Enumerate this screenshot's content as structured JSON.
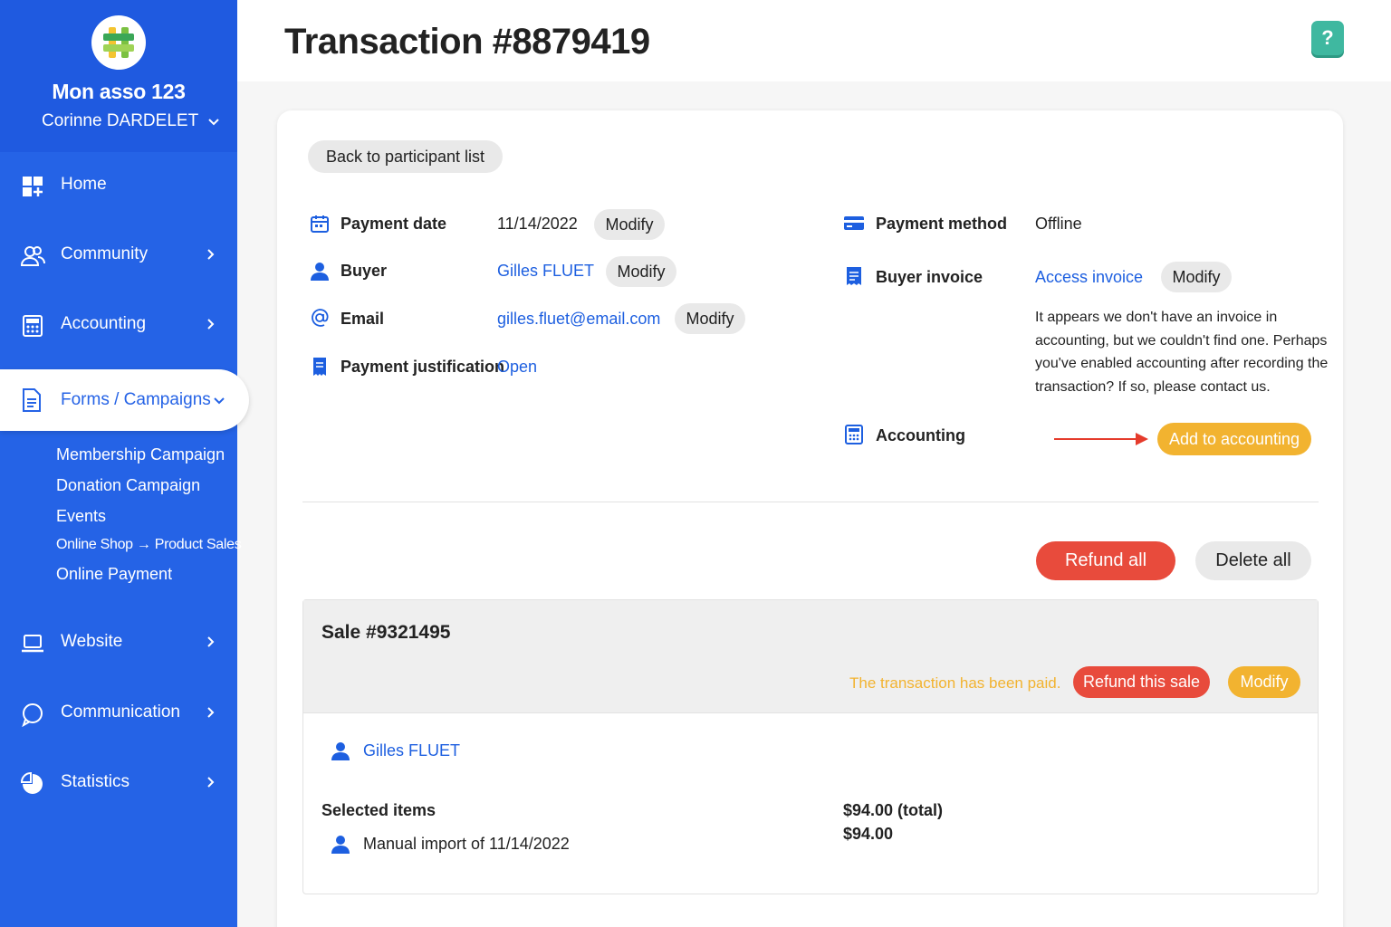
{
  "org": {
    "name": "Mon asso 123",
    "user": "Corinne DARDELET"
  },
  "nav": {
    "home": "Home",
    "community": "Community",
    "accounting": "Accounting",
    "forms": "Forms / Campaigns",
    "website": "Website",
    "communication": "Communication",
    "statistics": "Statistics",
    "sub_items": [
      "Membership Campaign",
      "Donation Campaign",
      "Events",
      "Online Shop → Product Sales",
      "Online Payment"
    ]
  },
  "header": {
    "title": "Transaction #8879419",
    "help": "?"
  },
  "back_button": "Back to participant list",
  "fields": {
    "payment_date_label": "Payment date",
    "payment_date_value": "11/14/2022",
    "buyer_label": "Buyer",
    "buyer_value": "Gilles FLUET",
    "email_label": "Email",
    "email_value": "gilles.fluet@email.com",
    "justification_label": "Payment justification",
    "justification_value": "Open",
    "modify": "Modify",
    "payment_method_label": "Payment method",
    "payment_method_value": "Offline",
    "buyer_invoice_label": "Buyer invoice",
    "buyer_invoice_value": "Access invoice",
    "invoice_note": "It appears we don't have an invoice in accounting, but we couldn't find one. Perhaps you've enabled accounting after recording the transaction? If so, please contact us.",
    "accounting_label": "Accounting",
    "add_to_accounting": "Add to accounting"
  },
  "actions": {
    "refund_all": "Refund all",
    "delete_all": "Delete all"
  },
  "sale": {
    "title": "Sale #9321495",
    "paid_status": "The transaction has been paid.",
    "refund_sale": "Refund this sale",
    "modify": "Modify",
    "person": "Gilles FLUET",
    "selected_items_label": "Selected items",
    "item_name": "Manual import of 11/14/2022",
    "total": "$94.00 (total)",
    "item_price": "$94.00"
  },
  "colors": {
    "sidebar": "#2563e6",
    "link": "#1d5fe0",
    "accent_yellow": "#f2b330",
    "danger_red": "#e84b3c",
    "help_green": "#3fb8a0"
  }
}
